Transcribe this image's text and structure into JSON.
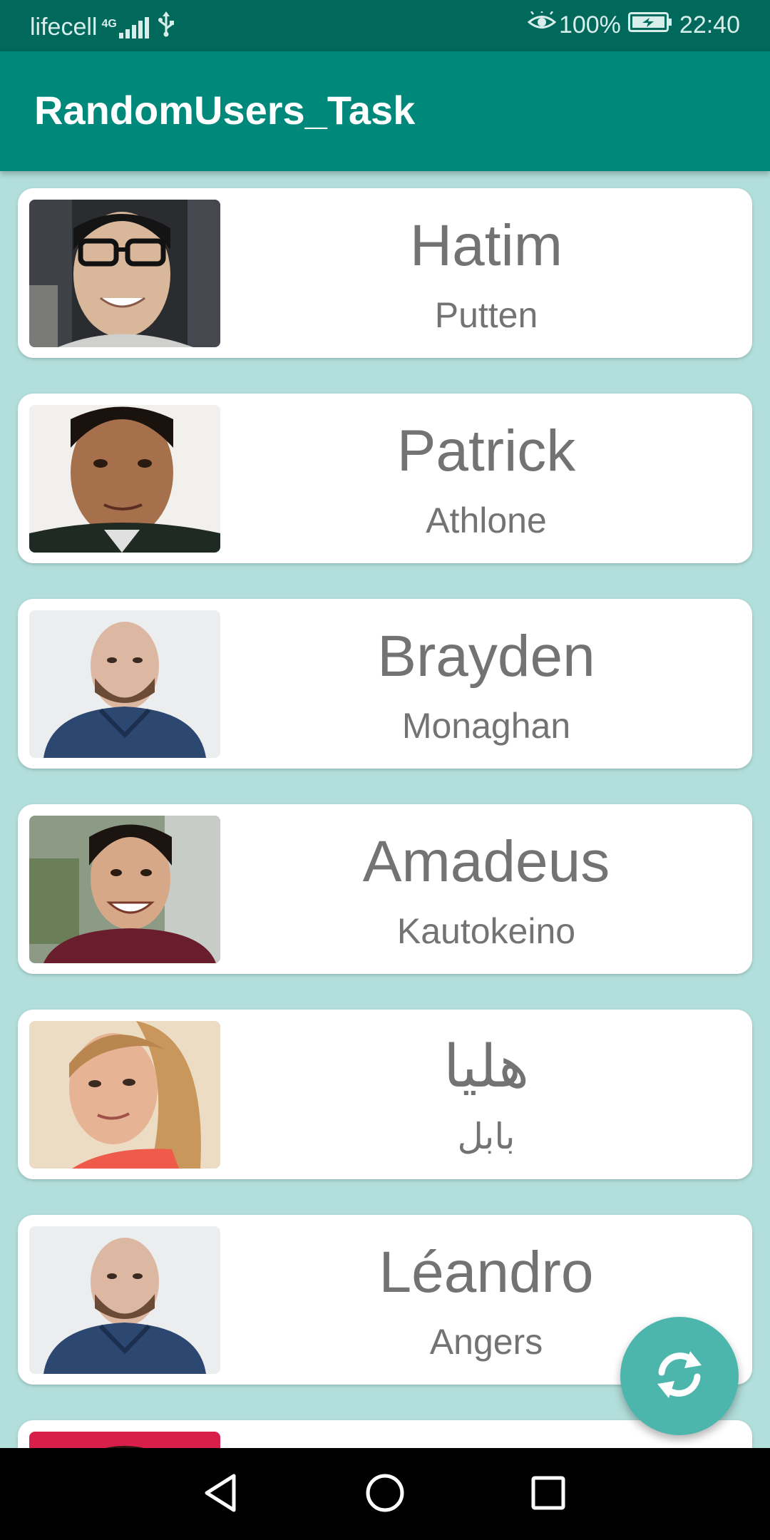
{
  "status_bar": {
    "carrier": "lifecell",
    "network": "4G",
    "battery": "100%",
    "time": "22:40",
    "icons": [
      "signal-icon",
      "usb-icon",
      "eye-icon",
      "battery-icon"
    ]
  },
  "app_bar": {
    "title": "RandomUsers_Task"
  },
  "users": [
    {
      "first_name": "Hatim",
      "city": "Putten"
    },
    {
      "first_name": "Patrick",
      "city": "Athlone"
    },
    {
      "first_name": "Brayden",
      "city": "Monaghan"
    },
    {
      "first_name": "Amadeus",
      "city": "Kautokeino"
    },
    {
      "first_name": "هلیا",
      "city": "بابل"
    },
    {
      "first_name": "Léandro",
      "city": "Angers"
    }
  ],
  "fab": {
    "icon": "refresh-icon"
  },
  "nav_bar": {
    "icons": [
      "back-icon",
      "home-icon",
      "recents-icon"
    ]
  },
  "colors": {
    "status_bar": "#00695c",
    "app_bar": "#00897b",
    "background": "#b2dfdb",
    "fab": "#4db6ac",
    "name_text": "#737373"
  }
}
